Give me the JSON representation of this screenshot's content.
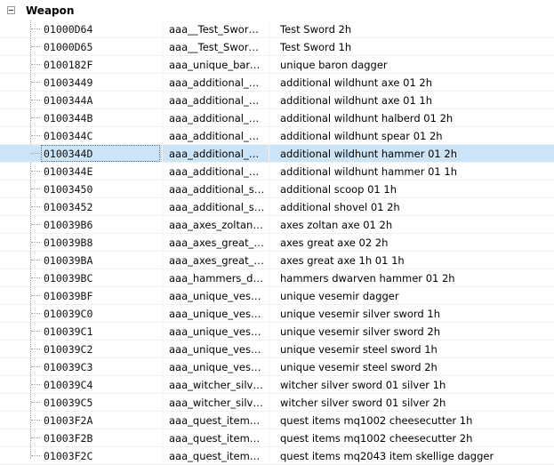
{
  "tree": {
    "group_label": "Weapon",
    "rows": [
      {
        "id": "01000D64",
        "edid": "aaa__Test_Sword_...",
        "name": "Test Sword 2h"
      },
      {
        "id": "01000D65",
        "edid": "aaa__Test_Sword_...",
        "name": "Test Sword 1h"
      },
      {
        "id": "0100182F",
        "edid": "aaa_unique_baron...",
        "name": "unique baron dagger"
      },
      {
        "id": "01003449",
        "edid": "aaa_additional_wil...",
        "name": "additional wildhunt axe 01 2h"
      },
      {
        "id": "0100344A",
        "edid": "aaa_additional_wil...",
        "name": "additional wildhunt axe 01 1h"
      },
      {
        "id": "0100344B",
        "edid": "aaa_additional_wil...",
        "name": "additional wildhunt halberd 01 2h"
      },
      {
        "id": "0100344C",
        "edid": "aaa_additional_wil...",
        "name": "additional wildhunt spear 01 2h"
      },
      {
        "id": "0100344D",
        "edid": "aaa_additional_wil...",
        "name": "additional wildhunt hammer 01 2h"
      },
      {
        "id": "0100344E",
        "edid": "aaa_additional_wil...",
        "name": "additional wildhunt hammer 01 1h"
      },
      {
        "id": "01003450",
        "edid": "aaa_additional_sc...",
        "name": "additional scoop 01 1h"
      },
      {
        "id": "01003452",
        "edid": "aaa_additional_sh...",
        "name": "additional shovel 01 2h"
      },
      {
        "id": "010039B6",
        "edid": "aaa_axes_zoltan_a...",
        "name": "axes zoltan axe 01 2h"
      },
      {
        "id": "010039B8",
        "edid": "aaa_axes_great_a...",
        "name": "axes great axe 02 2h"
      },
      {
        "id": "010039BA",
        "edid": "aaa_axes_great_a...",
        "name": "axes great axe 1h 01 1h"
      },
      {
        "id": "010039BC",
        "edid": "aaa_hammers_dw...",
        "name": "hammers dwarven hammer 01 2h"
      },
      {
        "id": "010039BF",
        "edid": "aaa_unique_vese...",
        "name": "unique vesemir dagger"
      },
      {
        "id": "010039C0",
        "edid": "aaa_unique_vese...",
        "name": "unique vesemir silver sword 1h"
      },
      {
        "id": "010039C1",
        "edid": "aaa_unique_vese...",
        "name": "unique vesemir silver sword 2h"
      },
      {
        "id": "010039C2",
        "edid": "aaa_unique_vese...",
        "name": "unique vesemir steel sword 1h"
      },
      {
        "id": "010039C3",
        "edid": "aaa_unique_vese...",
        "name": "unique vesemir steel sword 2h"
      },
      {
        "id": "010039C4",
        "edid": "aaa_witcher_silve...",
        "name": "witcher silver sword 01 silver 1h"
      },
      {
        "id": "010039C5",
        "edid": "aaa_witcher_silve...",
        "name": "witcher silver sword 01 silver 2h"
      },
      {
        "id": "01003F2A",
        "edid": "aaa_quest_items_...",
        "name": "quest items mq1002 cheesecutter 1h"
      },
      {
        "id": "01003F2B",
        "edid": "aaa_quest_items_...",
        "name": "quest items mq1002 cheesecutter 2h"
      },
      {
        "id": "01003F2C",
        "edid": "aaa_quest_items_...",
        "name": "quest items mq2043 item skellige dagger"
      }
    ]
  },
  "selection": {
    "index": 7,
    "highlight_color": "#cce4f7"
  }
}
